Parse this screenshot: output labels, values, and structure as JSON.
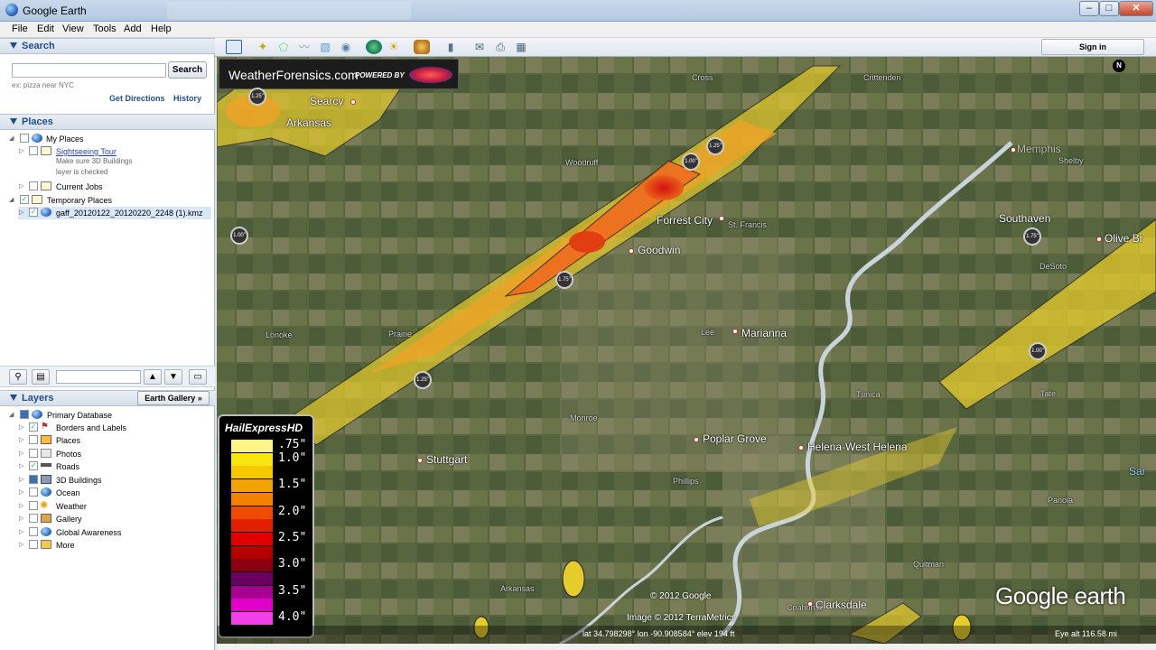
{
  "window": {
    "title": "Google Earth",
    "minimize": "–",
    "maximize": "□",
    "close": "✕"
  },
  "menu": {
    "items": [
      "File",
      "Edit",
      "View",
      "Tools",
      "Add",
      "Help"
    ]
  },
  "search": {
    "header": "Search",
    "input_value": "",
    "button": "Search",
    "hint": "ex: pizza near NYC",
    "get_directions": "Get Directions",
    "history": "History"
  },
  "places": {
    "header": "Places",
    "my_places": "My Places",
    "sightseeing": "Sightseeing Tour",
    "sightseeing_note_1": "Make sure 3D Buildings",
    "sightseeing_note_2": "layer is checked",
    "current_jobs": "Current Jobs",
    "temporary_places": "Temporary Places",
    "kmz_file": "gaff_20120122_20120220_2248 (1).kmz"
  },
  "layers": {
    "header": "Layers",
    "gallery_button": "Earth Gallery",
    "primary_database": "Primary Database",
    "items": [
      "Borders and Labels",
      "Places",
      "Photos",
      "Roads",
      "3D Buildings",
      "Ocean",
      "Weather",
      "Gallery",
      "Global Awareness",
      "More"
    ]
  },
  "toolbar": {
    "sign_in": "Sign in"
  },
  "map": {
    "banner_site": "WeatherForensics.com",
    "banner_powered": "POWERED BY",
    "compass": "N",
    "legend_title": "HailExpressHD",
    "legend": [
      {
        "label": ".75\"",
        "color": "#fdf685"
      },
      {
        "label": "1.0\"",
        "color": "#f9e60e"
      },
      {
        "label": "",
        "color": "#f5c800"
      },
      {
        "label": "1.5\"",
        "color": "#f4a200"
      },
      {
        "label": "",
        "color": "#f28300"
      },
      {
        "label": "2.0\"",
        "color": "#ef4c00"
      },
      {
        "label": "",
        "color": "#e22000"
      },
      {
        "label": "2.5\"",
        "color": "#e00000"
      },
      {
        "label": "",
        "color": "#b50000"
      },
      {
        "label": "3.0\"",
        "color": "#8a0010"
      },
      {
        "label": "",
        "color": "#6a0060"
      },
      {
        "label": "3.5\"",
        "color": "#a8008e"
      },
      {
        "label": "",
        "color": "#e000c8"
      },
      {
        "label": "4.0\"",
        "color": "#f040e8"
      }
    ],
    "labels": {
      "searcy": "Searcy",
      "arkansas": "Arkansas",
      "woodruff": "Woodruff",
      "cross": "Cross",
      "crittenden": "Crittenden",
      "memphis": "Memphis",
      "shelby": "Shelby",
      "southaven": "Southaven",
      "olive_branch": "Olive Br",
      "desoto": "DeSoto",
      "forrest_city": "Forrest City",
      "st_francis": "St. Francis",
      "goodwin": "Goodwin",
      "lonoke": "Lonoke",
      "prairie": "Prairie",
      "lee": "Lee",
      "marianna": "Marianna",
      "tunica": "Tunica",
      "tate": "Tate",
      "monroe": "Monroe",
      "poplar_grove": "Poplar Grove",
      "helena": "Helena-West Helena",
      "stuttgart": "Stuttgart",
      "phillips": "Phillips",
      "panola": "Panola",
      "quitman": "Quitman",
      "coahoma": "Coahoma",
      "clarksdale": "Clarksdale",
      "arkansas2": "Arkansas",
      "sardis": "Sar"
    },
    "hail_markers": [
      "1.25\"",
      "1.00\"",
      "1.25\"",
      "1.00\"",
      "1.75\"",
      "1.25\"",
      "1.75\"",
      "1.00\""
    ],
    "copyright_google": "© 2012 Google",
    "copyright_image": "Image © 2012 TerraMetrics",
    "coordinates": "lat   34.798298°  lon  -90.908584°  elev   194 ft",
    "eye_alt": "Eye alt   116.58 mi",
    "logo": "Google earth"
  }
}
